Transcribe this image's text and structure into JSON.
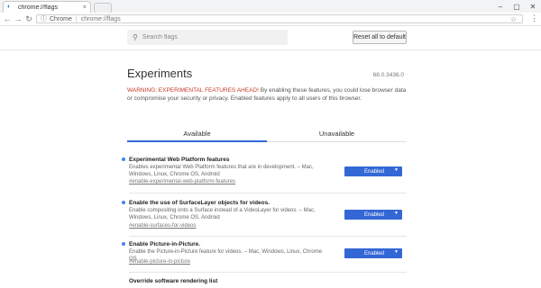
{
  "browser": {
    "tab_title": "chrome://flags",
    "tab_close": "×",
    "favicon": "◐",
    "window_controls": [
      "–",
      "▢",
      "✕"
    ]
  },
  "toolbar": {
    "back": "←",
    "forward": "→",
    "reload": "↻",
    "info_icon": "ⓘ",
    "site_label": "Chrome",
    "url": "chrome://flags",
    "star": "☆",
    "menu": "⋮"
  },
  "header": {
    "search_icon": "⚲",
    "search_placeholder": "Search flags",
    "reset_label": "Reset all to default"
  },
  "page": {
    "title": "Experiments",
    "version": "68.0.3436.0",
    "warning_head": "WARNING: EXPERIMENTAL FEATURES AHEAD!",
    "warning_body": " By enabling these features, you could lose browser data or compromise your security or privacy. Enabled features apply to all users of this browser."
  },
  "tabs": {
    "available": "Available",
    "unavailable": "Unavailable"
  },
  "flags": [
    {
      "name": "Experimental Web Platform features",
      "description": "Enables experimental Web Platform features that are in development. – Mac, Windows, Linux, Chrome OS, Android",
      "anchor": "#enable-experimental-web-platform-features",
      "state": "Enabled"
    },
    {
      "name": "Enable the use of SurfaceLayer objects for videos.",
      "description": "Enable compositing onto a Surface instead of a VideoLayer for videos. – Mac, Windows, Linux, Chrome OS, Android",
      "anchor": "#enable-surfaces-for-videos",
      "state": "Enabled"
    },
    {
      "name": "Enable Picture-in-Picture.",
      "description": "Enable the Picture-in-Picture feature for videos. – Mac, Windows, Linux, Chrome OS",
      "anchor": "#enable-picture-in-picture",
      "state": "Enabled"
    },
    {
      "name": "Override software rendering list"
    }
  ],
  "select_arrow": "▼",
  "colors": {
    "accent": "#3367d6",
    "warning": "#c53929",
    "flag_dot": "#4285f4"
  }
}
